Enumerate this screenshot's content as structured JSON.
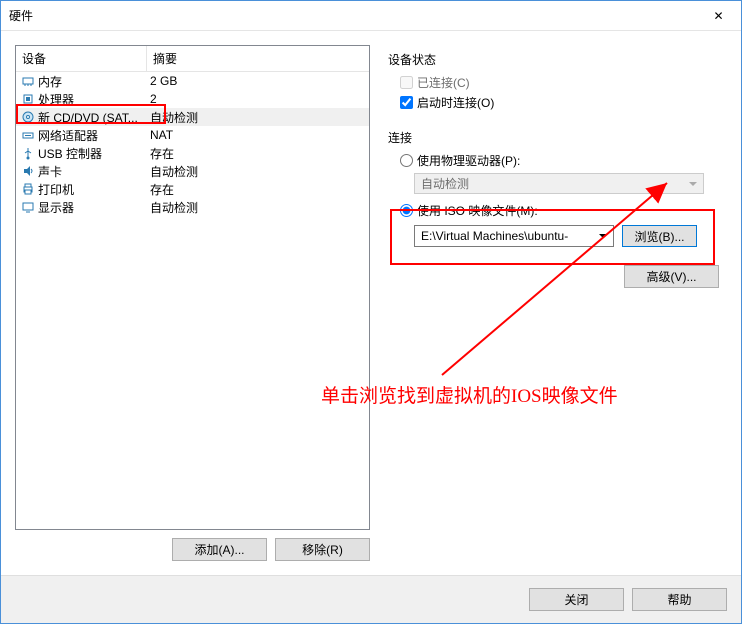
{
  "window": {
    "title": "硬件",
    "close_icon": "✕"
  },
  "device_headers": {
    "col1": "设备",
    "col2": "摘要"
  },
  "devices": [
    {
      "name": "内存",
      "summary": "2 GB",
      "icon": "memory"
    },
    {
      "name": "处理器",
      "summary": "2",
      "icon": "cpu"
    },
    {
      "name": "新 CD/DVD (SAT...",
      "summary": "自动检测",
      "icon": "disc",
      "selected": true
    },
    {
      "name": "网络适配器",
      "summary": "NAT",
      "icon": "net"
    },
    {
      "name": "USB 控制器",
      "summary": "存在",
      "icon": "usb"
    },
    {
      "name": "声卡",
      "summary": "自动检测",
      "icon": "sound"
    },
    {
      "name": "打印机",
      "summary": "存在",
      "icon": "printer"
    },
    {
      "name": "显示器",
      "summary": "自动检测",
      "icon": "display"
    }
  ],
  "left_buttons": {
    "add": "添加(A)...",
    "remove": "移除(R)"
  },
  "right": {
    "status_label": "设备状态",
    "connected": "已连接(C)",
    "connect_at_power_on": "启动时连接(O)",
    "connection_label": "连接",
    "use_physical": "使用物理驱动器(P):",
    "auto_detect": "自动检测",
    "use_iso": "使用 ISO 映像文件(M):",
    "iso_path": "E:\\Virtual Machines\\ubuntu-",
    "browse": "浏览(B)...",
    "advanced": "高级(V)..."
  },
  "bottom": {
    "close": "关闭",
    "help": "帮助"
  },
  "annotation": {
    "text": "单击浏览找到虚拟机的IOS映像文件"
  }
}
